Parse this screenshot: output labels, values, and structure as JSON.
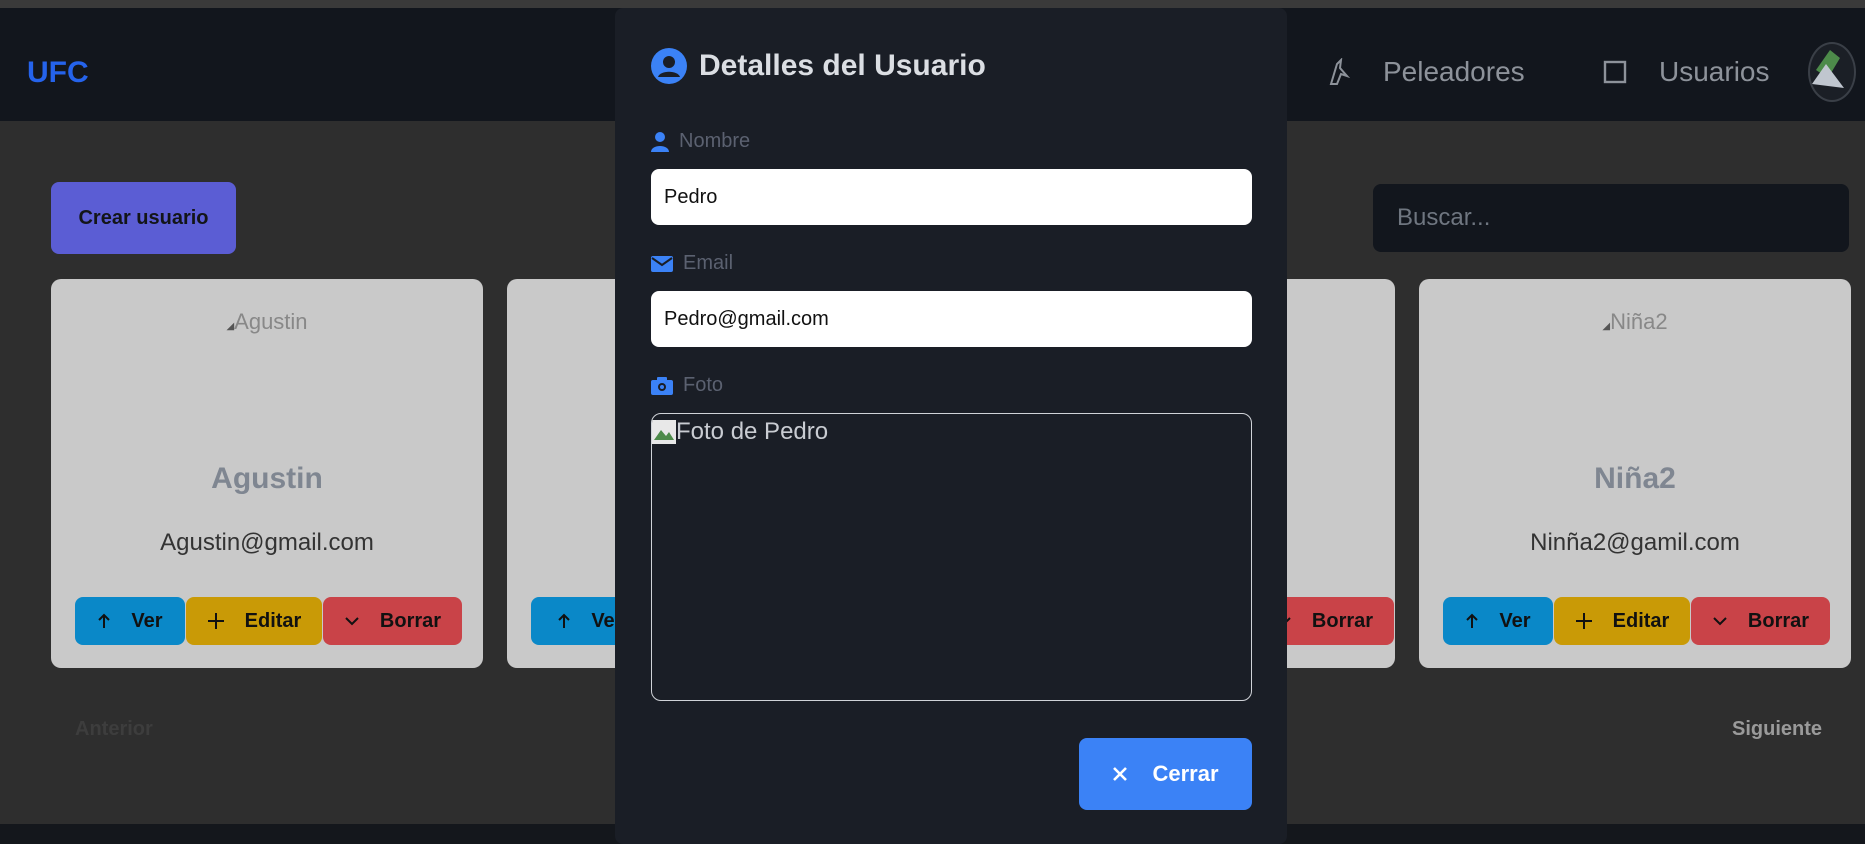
{
  "navbar": {
    "brand": "UFC",
    "items": [
      {
        "label": "Peleadores",
        "icon": "fighter-icon"
      },
      {
        "label": "Usuarios",
        "icon": "square-icon"
      }
    ]
  },
  "toolbar": {
    "create_label": "Crear usuario",
    "search_placeholder": "Buscar..."
  },
  "cards": [
    {
      "img_alt": "Agustin",
      "name": "Agustin",
      "email": "Agustin@gmail.com"
    },
    {
      "img_alt": "",
      "name": "",
      "email": ""
    },
    {
      "img_alt": "",
      "name": "",
      "email": ""
    },
    {
      "img_alt": "Niña2",
      "name": "Niña2",
      "email": "Ninña2@gamil.com"
    }
  ],
  "card_buttons": {
    "view": "Ver",
    "edit": "Editar",
    "delete": "Borrar",
    "partial_view": "Ve"
  },
  "pagination": {
    "prev": "Anterior",
    "next": "Siguiente"
  },
  "modal": {
    "title": "Detalles del Usuario",
    "name_label": "Nombre",
    "name_value": "Pedro",
    "email_label": "Email",
    "email_value": "Pedro@gmail.com",
    "photo_label": "Foto",
    "photo_alt": "Foto de Pedro",
    "close_label": "Cerrar"
  },
  "colors": {
    "accent": "#3b82f6",
    "brand": "#2563eb",
    "view_button": "#0a88c8",
    "edit_button": "#c99a06",
    "delete_button": "#c94348",
    "create_button": "#6366f1"
  }
}
